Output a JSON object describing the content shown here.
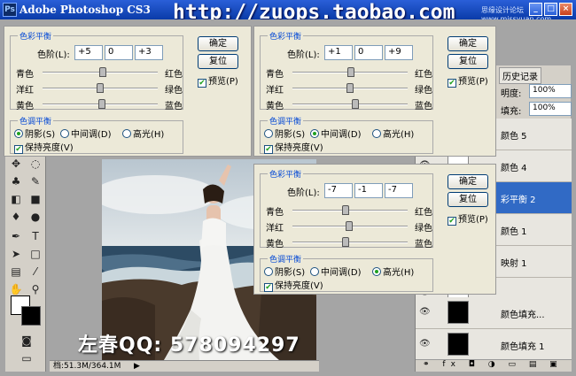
{
  "window": {
    "app_title": "Adobe Photoshop CS3",
    "icon_text": "Ps",
    "watermark": "http://zuops.taobao.com",
    "site_mark": "思缘设计论坛 www.missyuan.com"
  },
  "layers_panel": {
    "history_tab": "历史记录",
    "opacity_label": "明度:",
    "opacity_value": "100%",
    "fill_label": "填充:",
    "fill_value": "100%",
    "layers": [
      "颜色 5",
      "颜色 4",
      "彩平衡 2",
      "颜色 1",
      "映射 1",
      "",
      "颜色填充...",
      "颜色填充 1"
    ],
    "footer_icons": "⚭ fx ◘ ◑ ▭ ▤ ▣"
  },
  "status": {
    "doc_info": "档:51.3M/364.1M",
    "arrow": "▶"
  },
  "credit": "左春QQ: 578094297",
  "dialogs": [
    {
      "title": "色彩平衡",
      "levels_label": "色阶(L):",
      "levels": [
        "+5",
        "0",
        "+3"
      ],
      "sliders": [
        {
          "left": "青色",
          "right": "红色",
          "value": 5
        },
        {
          "left": "洋红",
          "right": "绿色",
          "value": 0
        },
        {
          "left": "黄色",
          "right": "蓝色",
          "value": 3
        }
      ],
      "ok": "确定",
      "reset": "复位",
      "preview": "预览(P)",
      "tone_title": "色调平衡",
      "tones": [
        "阴影(S)",
        "中间调(D)",
        "高光(H)"
      ],
      "selected_tone": 0,
      "preserve": "保持亮度(V)"
    },
    {
      "title": "色彩平衡",
      "levels_label": "色阶(L):",
      "levels": [
        "+1",
        "0",
        "+9"
      ],
      "sliders": [
        {
          "left": "青色",
          "right": "红色",
          "value": 1
        },
        {
          "left": "洋红",
          "right": "绿色",
          "value": 0
        },
        {
          "left": "黄色",
          "right": "蓝色",
          "value": 9
        }
      ],
      "ok": "确定",
      "reset": "复位",
      "preview": "预览(P)",
      "tone_title": "色调平衡",
      "tones": [
        "阴影(S)",
        "中间调(D)",
        "高光(H)"
      ],
      "selected_tone": 1,
      "preserve": "保持亮度(V)"
    },
    {
      "title": "色彩平衡",
      "levels_label": "色阶(L):",
      "levels": [
        "-7",
        "-1",
        "-7"
      ],
      "sliders": [
        {
          "left": "青色",
          "right": "红色",
          "value": -7
        },
        {
          "left": "洋红",
          "right": "绿色",
          "value": -1
        },
        {
          "left": "黄色",
          "right": "蓝色",
          "value": -7
        }
      ],
      "ok": "确定",
      "reset": "复位",
      "preview": "预览(P)",
      "tone_title": "色调平衡",
      "tones": [
        "阴影(S)",
        "中间调(D)",
        "高光(H)"
      ],
      "selected_tone": 2,
      "preserve": "保持亮度(V)"
    }
  ]
}
